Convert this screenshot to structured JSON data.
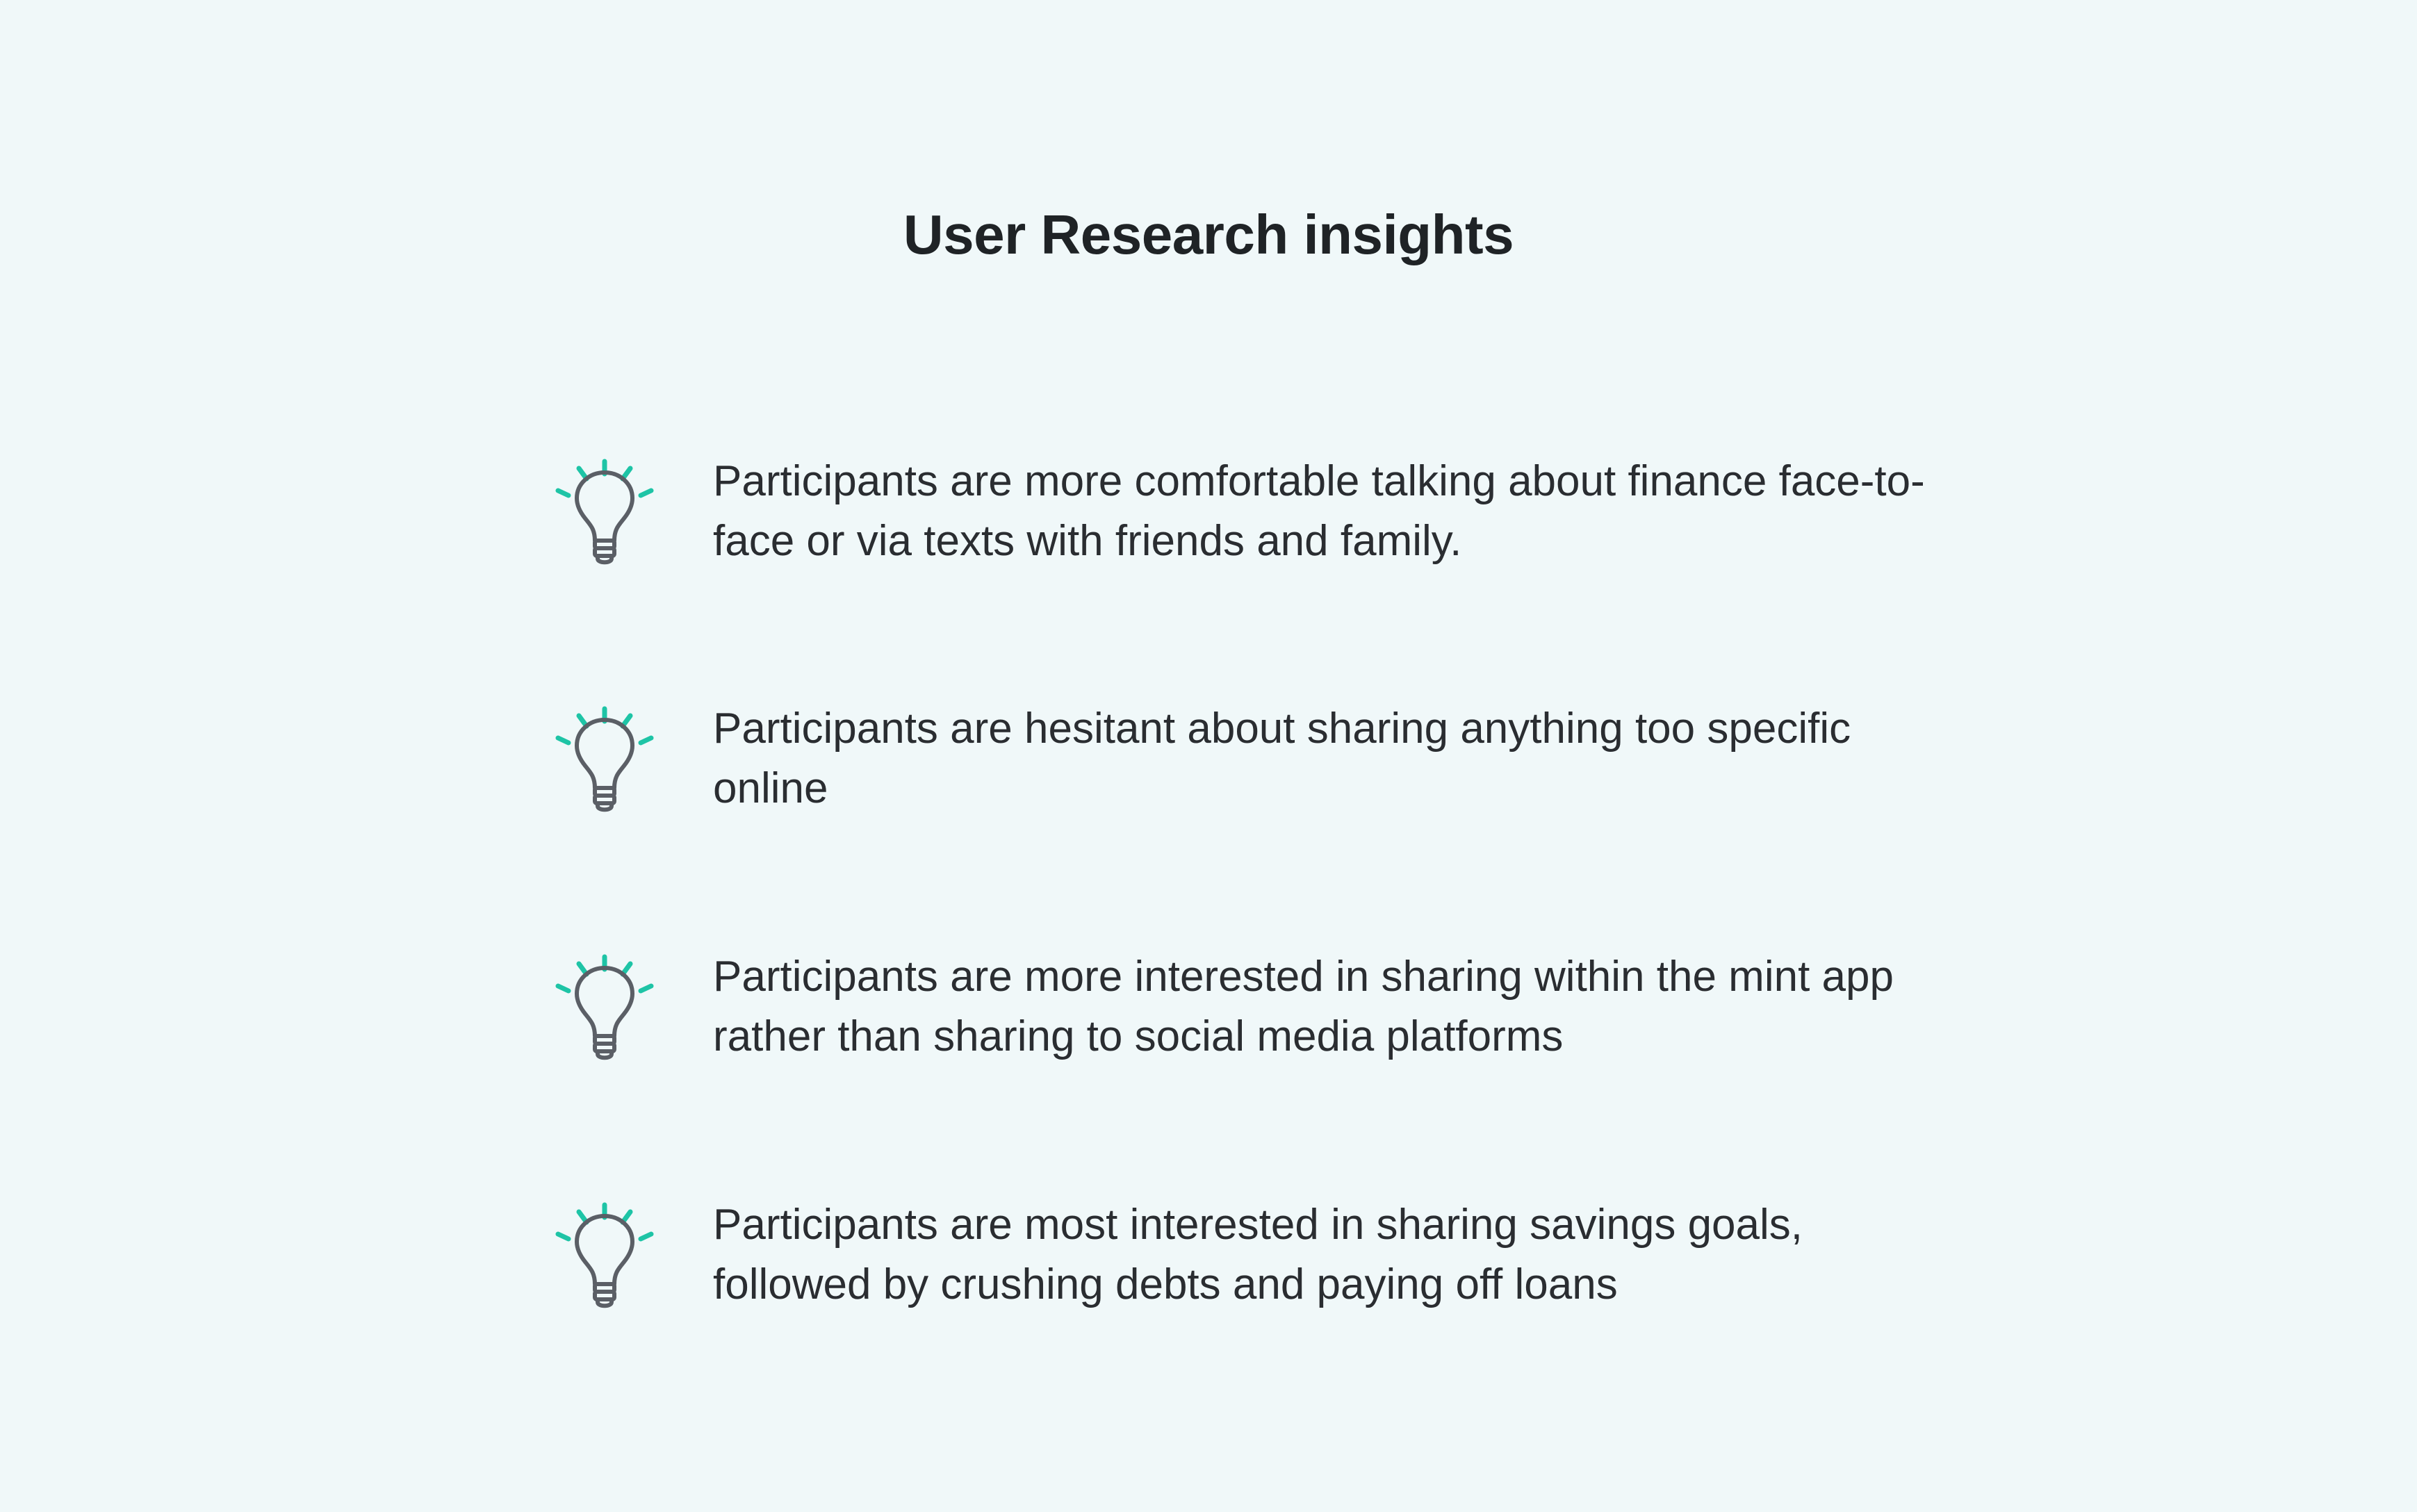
{
  "title": "User Research insights",
  "accent_color": "#1ec4a6",
  "icon_stroke_color": "#5b5f66",
  "insights": [
    {
      "icon": "lightbulb-icon",
      "text": "Participants are more comfortable talking about finance face-to-face or via texts with friends and family."
    },
    {
      "icon": "lightbulb-icon",
      "text": "Participants are hesitant about sharing anything too specific online"
    },
    {
      "icon": "lightbulb-icon",
      "text": "Participants are more interested in sharing within the mint app rather than sharing to social media platforms"
    },
    {
      "icon": "lightbulb-icon",
      "text": "Participants are most interested in sharing savings goals, followed by crushing debts and paying off loans"
    }
  ]
}
